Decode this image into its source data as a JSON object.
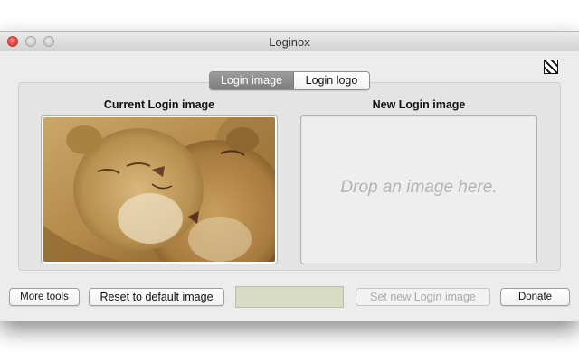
{
  "window": {
    "title": "Loginox"
  },
  "tabs": [
    {
      "label": "Login image",
      "active": true
    },
    {
      "label": "Login logo",
      "active": false
    }
  ],
  "current": {
    "title": "Current Login image",
    "image_subject": "two lionesses nuzzling"
  },
  "new_image": {
    "title": "New Login image",
    "drop_text": "Drop an image here."
  },
  "buttons": {
    "more_tools": "More tools",
    "reset": "Reset to default image",
    "set_new": "Set new Login image",
    "donate": "Donate"
  },
  "colors": {
    "close": "#e0443b",
    "tab_active": "#8a8a8a",
    "color_well": "#d8dcc5",
    "drop_text": "#b3b3b3"
  },
  "icons": {
    "corner": "striped-square-icon"
  }
}
